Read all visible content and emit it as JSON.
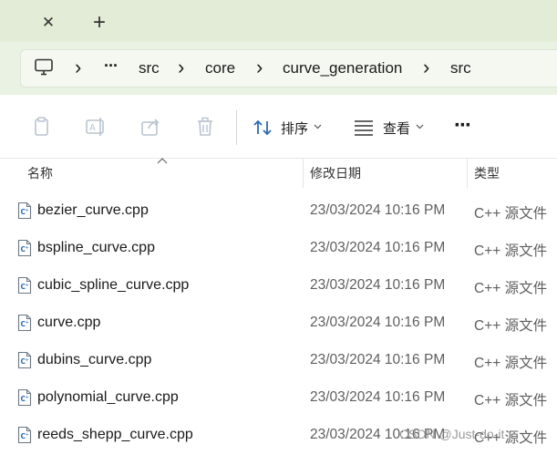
{
  "tabs": {
    "close_glyph": "✕",
    "new_glyph": "+"
  },
  "address": {
    "overflow": "···",
    "separator": "›",
    "crumbs": [
      "src",
      "core",
      "curve_generation",
      "src"
    ]
  },
  "toolbar": {
    "sort_label": "排序",
    "view_label": "查看",
    "more_glyph": "···",
    "icons": [
      "copy-icon",
      "rename-icon",
      "share-icon",
      "delete-icon",
      "sort-icon",
      "view-icon"
    ]
  },
  "columns": {
    "name": "名称",
    "modified": "修改日期",
    "type": "类型"
  },
  "files": [
    {
      "name": "bezier_curve.cpp",
      "date": "23/03/2024 10:16 PM",
      "type": "C++ 源文件"
    },
    {
      "name": "bspline_curve.cpp",
      "date": "23/03/2024 10:16 PM",
      "type": "C++ 源文件"
    },
    {
      "name": "cubic_spline_curve.cpp",
      "date": "23/03/2024 10:16 PM",
      "type": "C++ 源文件"
    },
    {
      "name": "curve.cpp",
      "date": "23/03/2024 10:16 PM",
      "type": "C++ 源文件"
    },
    {
      "name": "dubins_curve.cpp",
      "date": "23/03/2024 10:16 PM",
      "type": "C++ 源文件"
    },
    {
      "name": "polynomial_curve.cpp",
      "date": "23/03/2024 10:16 PM",
      "type": "C++ 源文件"
    },
    {
      "name": "reeds_shepp_curve.cpp",
      "date": "23/03/2024 10:16 PM",
      "type": "C++ 源文件"
    }
  ],
  "watermark": "CSDN @Just-do-it",
  "colors": {
    "tabstrip": "#e3ecd7",
    "addressbar": "#eaf2e4",
    "icon_accent": "#2b6cb0"
  }
}
